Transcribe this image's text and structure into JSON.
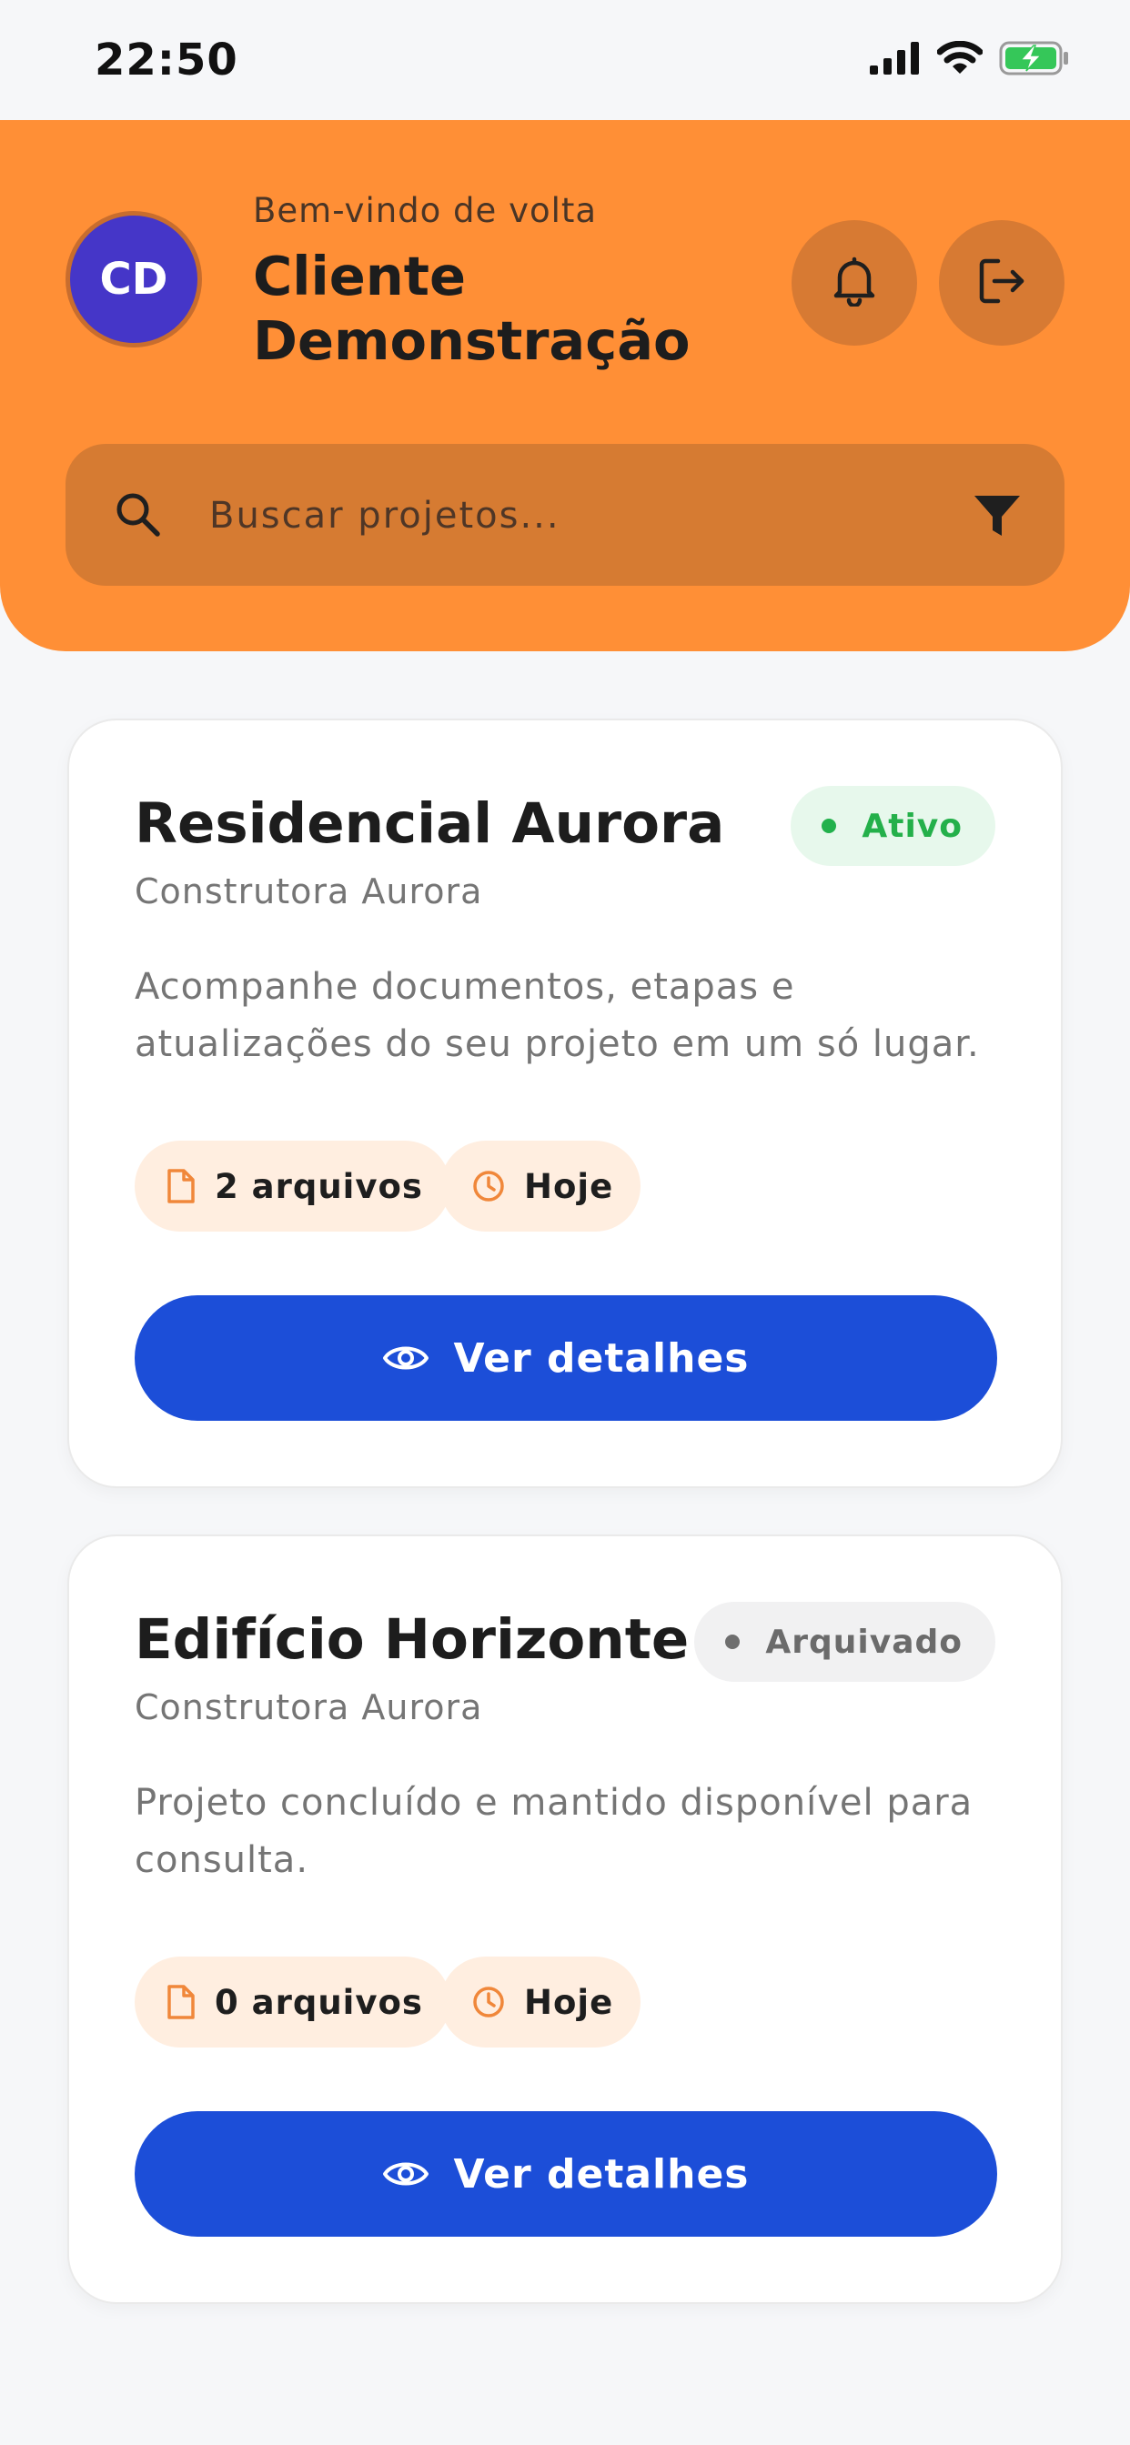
{
  "status_bar": {
    "time": "22:50",
    "icons": [
      "cellular-signal-icon",
      "wifi-icon",
      "battery-charging-icon"
    ]
  },
  "header": {
    "avatar_initials": "CD",
    "greeting": "Bem-vindo de volta",
    "user_name": "Cliente Demonstração",
    "actions": [
      "bell-icon",
      "logout-icon"
    ],
    "search": {
      "placeholder": "Buscar projetos...",
      "value": ""
    },
    "colors": {
      "header_bg": "#ff8f36",
      "avatar_bg": "#4536c8"
    }
  },
  "projects": [
    {
      "title": "Residencial Aurora",
      "company": "Construtora Aurora",
      "description": "Acompanhe documentos, etapas e atualizações do seu projeto em um só lugar.",
      "status": "Ativo",
      "status_color": "#24b04a",
      "files_label": "2 arquivos",
      "date_label": "Hoje",
      "button_label": "Ver detalhes"
    },
    {
      "title": "Edifício Horizonte",
      "company": "Construtora Aurora",
      "description": "Projeto concluído e mantido disponível para consulta.",
      "status": "Arquivado",
      "status_color": "#6b6b6b",
      "files_label": "0 arquivos",
      "date_label": "Hoje",
      "button_label": "Ver detalhes"
    }
  ],
  "colors": {
    "primary_button": "#1c4ed8",
    "chip_bg": "#ffeee0",
    "accent_orange": "#ff8f36"
  }
}
